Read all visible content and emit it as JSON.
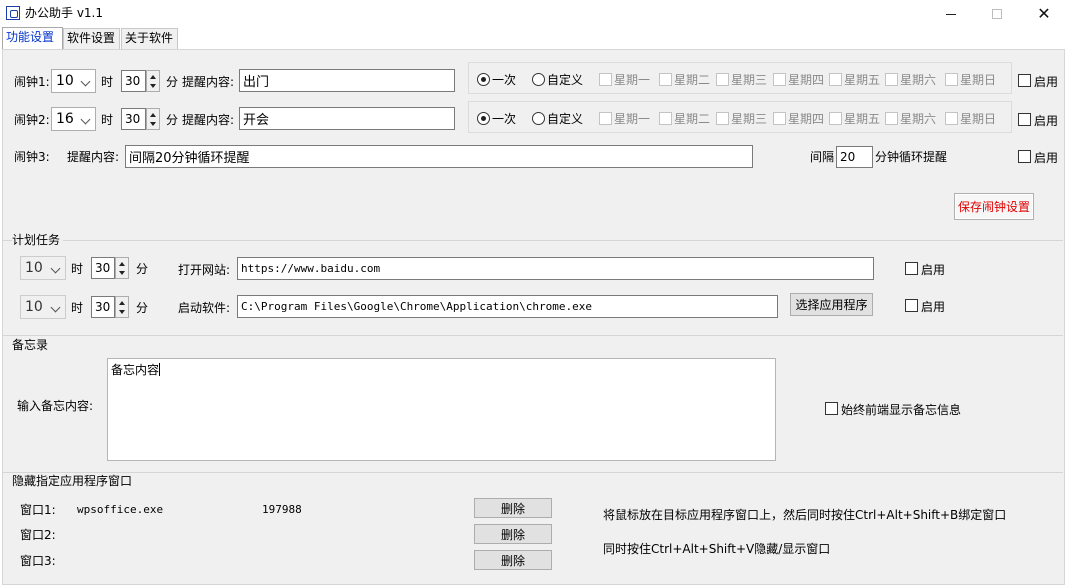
{
  "window": {
    "title": "办公助手 v1.1",
    "close_glyph": "✕"
  },
  "tabs": [
    "功能设置",
    "软件设置",
    "关于软件"
  ],
  "alarms": [
    {
      "label": "闹钟1:",
      "hour": "10",
      "hour_unit": "时",
      "minute": "30",
      "minute_unit": "分",
      "content_label": "提醒内容:",
      "content": "出门",
      "enable_label": "启用"
    },
    {
      "label": "闹钟2:",
      "hour": "16",
      "hour_unit": "时",
      "minute": "30",
      "minute_unit": "分",
      "content_label": "提醒内容:",
      "content": "开会",
      "enable_label": "启用"
    }
  ],
  "repeat": {
    "once_label": "一次",
    "custom_label": "自定义",
    "weekdays": [
      "星期一",
      "星期二",
      "星期三",
      "星期四",
      "星期五",
      "星期六",
      "星期日"
    ]
  },
  "alarm3": {
    "label": "闹钟3:",
    "content_label": "提醒内容:",
    "content": "间隔20分钟循环提醒",
    "interval_label": "间隔",
    "interval": "20",
    "interval_suffix": "分钟循环提醒",
    "enable_label": "启用"
  },
  "save_button": "保存闹钟设置",
  "schedule": {
    "title": "计划任务",
    "tasks": [
      {
        "hour": "10",
        "hour_unit": "时",
        "minute": "30",
        "minute_unit": "分",
        "action_label": "打开网站:",
        "value": "https://www.baidu.com",
        "enable_label": "启用"
      },
      {
        "hour": "10",
        "hour_unit": "时",
        "minute": "30",
        "minute_unit": "分",
        "action_label": "启动软件:",
        "value": "C:\\Program Files\\Google\\Chrome\\Application\\chrome.exe",
        "enable_label": "启用",
        "browse_label": "选择应用程序"
      }
    ]
  },
  "memo": {
    "title": "备忘录",
    "input_label": "输入备忘内容:",
    "content": "备忘内容",
    "topmost_label": "始终前端显示备忘信息"
  },
  "hide": {
    "title": "隐藏指定应用程序窗口",
    "windows": [
      {
        "label": "窗口1:",
        "name": "wpsoffice.exe",
        "handle": "197988",
        "delete_label": "删除"
      },
      {
        "label": "窗口2:",
        "name": "",
        "handle": "",
        "delete_label": "删除"
      },
      {
        "label": "窗口3:",
        "name": "",
        "handle": "",
        "delete_label": "删除"
      }
    ],
    "hint1": "将鼠标放在目标应用程序窗口上，然后同时按住Ctrl+Alt+Shift+B绑定窗口",
    "hint2": "同时按住Ctrl+Alt+Shift+V隐藏/显示窗口"
  }
}
